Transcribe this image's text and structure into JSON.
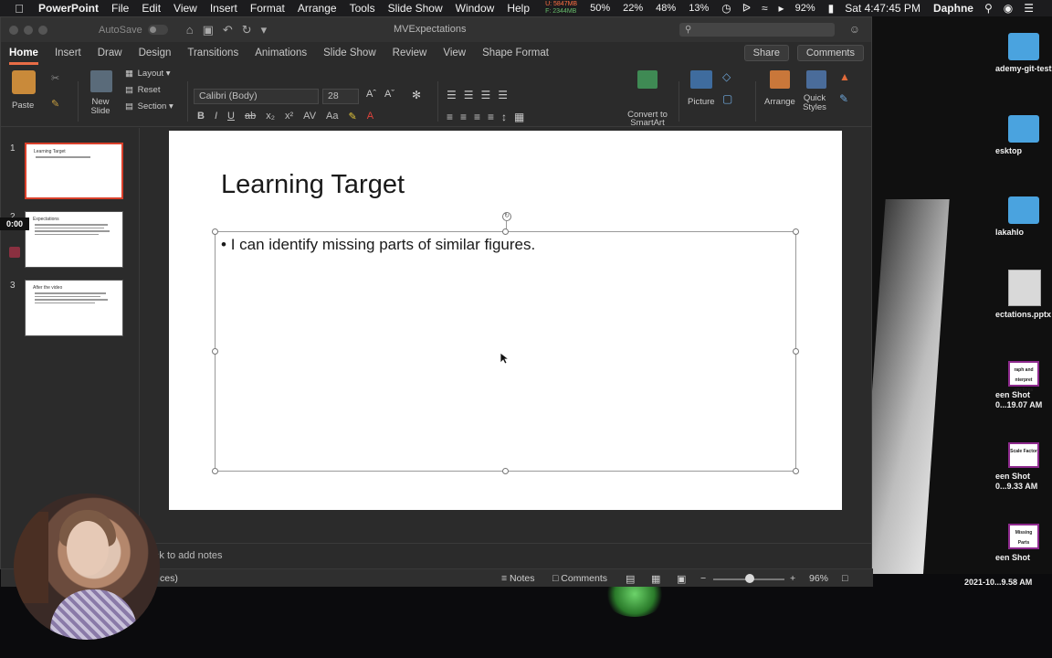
{
  "menubar": {
    "app_name": "PowerPoint",
    "items": [
      "File",
      "Edit",
      "View",
      "Insert",
      "Format",
      "Arrange",
      "Tools",
      "Slide Show",
      "Window",
      "Help"
    ],
    "mem_used": "U: 5847MB",
    "mem_free": "F: 2344MB",
    "stats": [
      "50%",
      "22%",
      "48%",
      "13%"
    ],
    "battery": "92%",
    "clock": "Sat 4:47:45 PM",
    "user": "Daphne"
  },
  "titlebar": {
    "autosave": "AutoSave",
    "autosave_state": "OFF",
    "doc_title": "MVExpectations"
  },
  "tabs": [
    "Home",
    "Insert",
    "Draw",
    "Design",
    "Transitions",
    "Animations",
    "Slide Show",
    "Review",
    "View",
    "Shape Format"
  ],
  "tabs_right": {
    "share": "Share",
    "comments": "Comments"
  },
  "ribbon": {
    "paste": "Paste",
    "new_slide": "New\nSlide",
    "layout": "Layout",
    "reset": "Reset",
    "section": "Section",
    "font_name": "Calibri (Body)",
    "font_size": "28",
    "convert": "Convert to SmartArt",
    "picture": "Picture",
    "arrange": "Arrange",
    "quick_styles": "Quick Styles"
  },
  "thumbnails": [
    {
      "num": "1",
      "title": "Learning Target"
    },
    {
      "num": "2",
      "title": "Expectations"
    },
    {
      "num": "3",
      "title": "After the video"
    }
  ],
  "slide": {
    "title": "Learning Target",
    "bullet": "I can identify missing parts of similar figures."
  },
  "notes": {
    "placeholder": "lick to add notes"
  },
  "status": {
    "left": "ces)",
    "notes": "Notes",
    "comments": "Comments",
    "zoom": "96%"
  },
  "recorder": {
    "timer": "0:00"
  },
  "desktop": {
    "items": [
      "ademy-git-test",
      "esktop",
      "lakahlo",
      "ectations.pptx",
      "een Shot 0...19.07 AM",
      "een Shot 0...9.33 AM",
      "een Shot"
    ],
    "bottom": "2021-10...9.58 AM",
    "doc_thumbs": [
      "raph and nterpret unctions",
      "Scale Factor",
      "Missing Parts"
    ]
  }
}
